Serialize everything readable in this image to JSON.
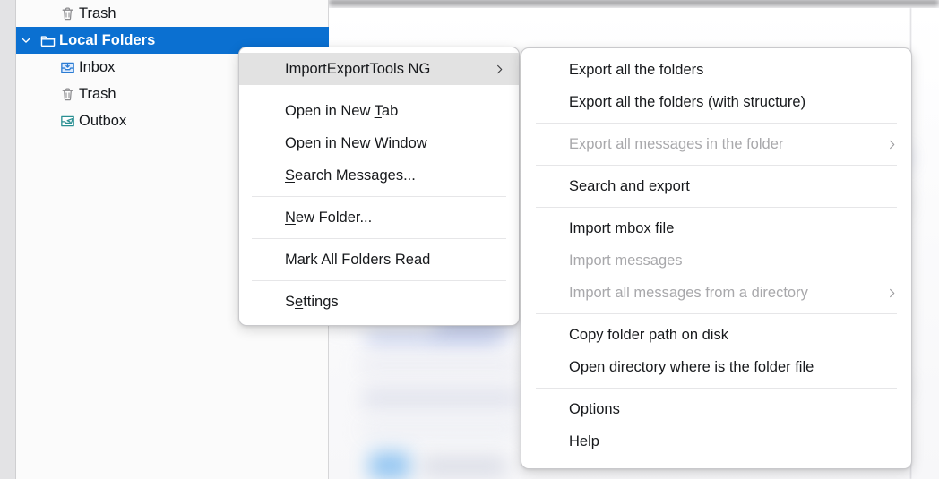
{
  "colors": {
    "selection_blue": "#0b70d1",
    "menu_hover_grey": "#e2e2e2",
    "menu_background": "#ffffff",
    "disabled_text": "#a8a8ab",
    "text": "#17191c",
    "folder_icon_blue": "#2b7cd3",
    "outbox_icon_teal": "#2a8f92",
    "trash_icon_grey": "#8a8a8d"
  },
  "folder_pane": {
    "rows": [
      {
        "label": "Trash",
        "icon": "trash-icon",
        "level": 1,
        "selected": false,
        "twisty": "none"
      },
      {
        "label": "Local Folders",
        "icon": "folder-icon",
        "level": 0,
        "selected": true,
        "twisty": "chevron-down"
      },
      {
        "label": "Inbox",
        "icon": "inbox-icon",
        "level": 1,
        "selected": false,
        "twisty": "none"
      },
      {
        "label": "Trash",
        "icon": "trash-icon",
        "level": 1,
        "selected": false,
        "twisty": "none"
      },
      {
        "label": "Outbox",
        "icon": "outbox-icon",
        "level": 1,
        "selected": false,
        "twisty": "none"
      }
    ]
  },
  "context_menu": {
    "items": [
      {
        "label": "ImportExportTools NG",
        "highlighted": true,
        "disabled": false,
        "submenu": true,
        "accel": ""
      },
      {
        "type": "separator"
      },
      {
        "label": "Open in New Tab",
        "highlighted": false,
        "disabled": false,
        "submenu": false,
        "accel": "T"
      },
      {
        "label": "Open in New Window",
        "highlighted": false,
        "disabled": false,
        "submenu": false,
        "accel": "O"
      },
      {
        "label": "Search Messages...",
        "highlighted": false,
        "disabled": false,
        "submenu": false,
        "accel": "S"
      },
      {
        "type": "separator"
      },
      {
        "label": "New Folder...",
        "highlighted": false,
        "disabled": false,
        "submenu": false,
        "accel": "N"
      },
      {
        "type": "separator"
      },
      {
        "label": "Mark All Folders Read",
        "highlighted": false,
        "disabled": false,
        "submenu": false,
        "accel": ""
      },
      {
        "type": "separator"
      },
      {
        "label": "Settings",
        "highlighted": false,
        "disabled": false,
        "submenu": false,
        "accel": "e"
      }
    ]
  },
  "submenu": {
    "items": [
      {
        "label": "Export all the folders",
        "disabled": false,
        "submenu": false
      },
      {
        "label": "Export all the folders (with structure)",
        "disabled": false,
        "submenu": false
      },
      {
        "type": "separator"
      },
      {
        "label": "Export all messages in the folder",
        "disabled": true,
        "submenu": true
      },
      {
        "type": "separator"
      },
      {
        "label": "Search and export",
        "disabled": false,
        "submenu": false
      },
      {
        "type": "separator"
      },
      {
        "label": "Import mbox file",
        "disabled": false,
        "submenu": false
      },
      {
        "label": "Import messages",
        "disabled": true,
        "submenu": false
      },
      {
        "label": "Import all messages from a directory",
        "disabled": true,
        "submenu": true
      },
      {
        "type": "separator"
      },
      {
        "label": "Copy folder path on disk",
        "disabled": false,
        "submenu": false
      },
      {
        "label": "Open directory where is the folder file",
        "disabled": false,
        "submenu": false
      },
      {
        "type": "separator"
      },
      {
        "label": "Options",
        "disabled": false,
        "submenu": false
      },
      {
        "label": "Help",
        "disabled": false,
        "submenu": false
      }
    ]
  }
}
